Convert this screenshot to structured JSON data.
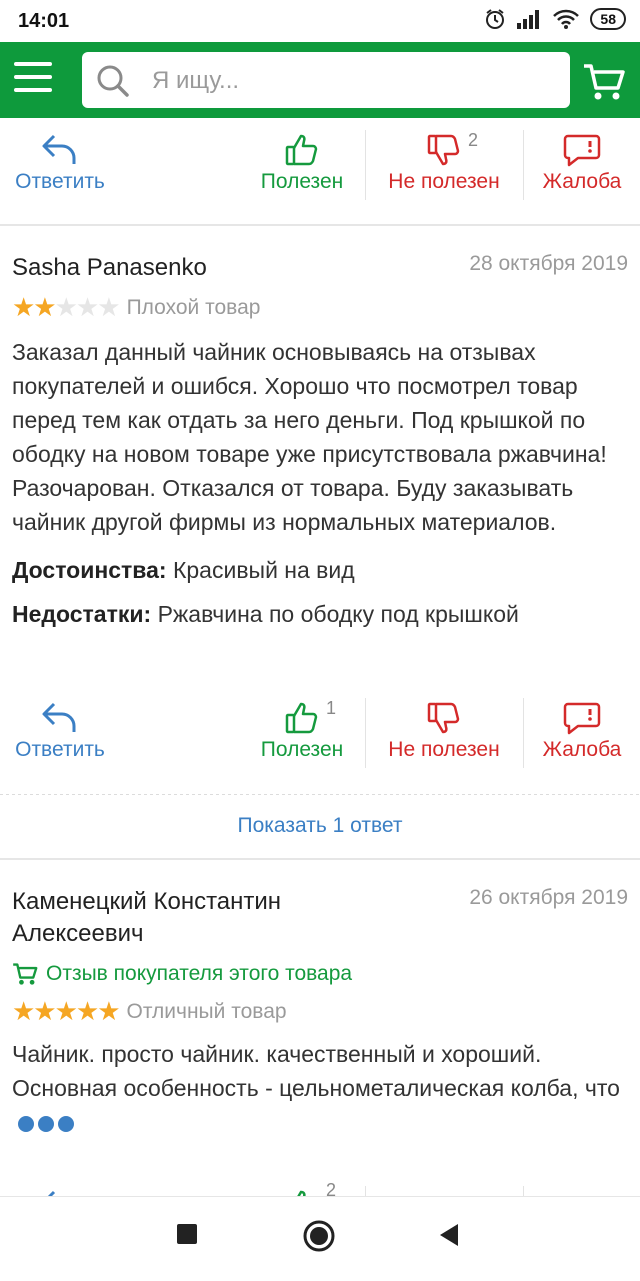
{
  "status_bar": {
    "time": "14:01",
    "battery": "58"
  },
  "search": {
    "placeholder": "Я ищу..."
  },
  "actions": {
    "reply": "Ответить",
    "useful": "Полезен",
    "not_useful": "Не полезен",
    "complaint": "Жалоба"
  },
  "top_row": {
    "not_useful_count": "2"
  },
  "reviews": [
    {
      "author": "Sasha Panasenko",
      "date": "28 октября 2019",
      "rating": 2,
      "rating_text": "Плохой товар",
      "text": "Заказал данный чайник основываясь на отзывах покупателей и ошибся. Хорошо что посмотрел товар перед тем как отдать за него деньги. Под крышкой по ободку на новом товаре уже присутствовала ржавчина! Разочарован. Отказался от товара. Буду заказывать чайник другой фирмы из нормальных материалов.",
      "pros_label": "Достоинства:",
      "pros": "Красивый на вид",
      "cons_label": "Недостатки:",
      "cons": "Ржавчина по ободку под крышкой",
      "useful_count": "1",
      "show_answers": "Показать 1 ответ"
    },
    {
      "author": "Каменецкий Константин Алексеевич",
      "date": "26 октября 2019",
      "buyer_badge": "Отзыв покупателя этого товара",
      "rating": 5,
      "rating_text": "Отличный товар",
      "text": "Чайник. просто чайник. качественный и хороший. Основная особенность - цельнометалическая колба, что",
      "useful_count": "2"
    }
  ],
  "colors": {
    "brand_green": "#0e9a3c",
    "link_blue": "#3b7fc4",
    "danger_red": "#d42a2a",
    "star_gold": "#f5a623"
  }
}
